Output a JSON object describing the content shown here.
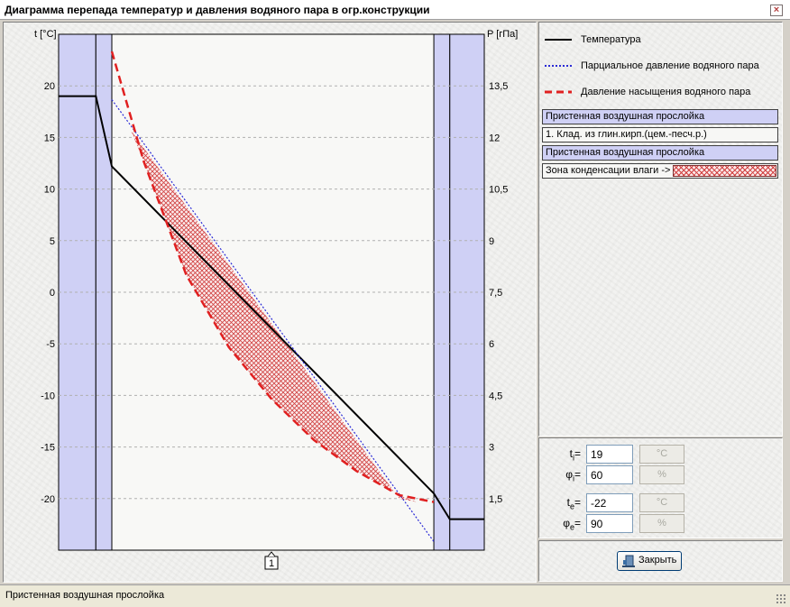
{
  "window": {
    "title": "Диаграмма перепада температур и давления водяного пара в огр.конструкции",
    "close_glyph": "×"
  },
  "legend": {
    "items": [
      {
        "label": "Температура",
        "color": "#000000",
        "style": "solid"
      },
      {
        "label": "Парциальное давление водяного пара",
        "color": "#2b2bd6",
        "style": "dotted"
      },
      {
        "label": "Давление насыщения водяного пара",
        "color": "#e02020",
        "style": "dashed"
      }
    ]
  },
  "layers": {
    "items": [
      "Пристенная воздушная прослойка",
      "1. Клад. из глин.кирп.(цем.-песч.р.)",
      "Пристенная воздушная прослойка"
    ],
    "condensation_label": "Зона конденсации влаги ->",
    "colors": {
      "air": "#cfd0f5",
      "condensation": "#d04040"
    }
  },
  "params": {
    "ti": {
      "sym": "t",
      "sub": "i",
      "value": "19",
      "unit": "°C"
    },
    "phii": {
      "sym": "φ",
      "sub": "i",
      "value": "60",
      "unit": "%"
    },
    "te": {
      "sym": "t",
      "sub": "e",
      "value": "-22",
      "unit": "°C"
    },
    "phie": {
      "sym": "φ",
      "sub": "e",
      "value": "90",
      "unit": "%"
    }
  },
  "close_button_label": "Закрыть",
  "status_text": "Пристенная воздушная прослойка",
  "chart_data": {
    "type": "line",
    "left_axis_label": "t [°C]",
    "right_axis_label": "P [гПа]",
    "left_ylim": [
      -25,
      25
    ],
    "left_ticks": [
      20,
      15,
      10,
      5,
      0,
      -5,
      -10,
      -15,
      -20
    ],
    "right_ylim": [
      0,
      15
    ],
    "right_ticks": [
      13.5,
      12,
      10.5,
      9,
      7.5,
      6,
      4.5,
      3,
      1.5
    ],
    "right_tick_labels": [
      "13,5",
      "12",
      "10,5",
      "9",
      "7,5",
      "6",
      "4,5",
      "3",
      "1,5"
    ],
    "grid": true,
    "layer_boundaries": [
      0,
      0.0875,
      0.125,
      0.8815,
      0.919,
      1
    ],
    "x_marker_label": "1",
    "x_marker_pos": 0.5,
    "series": [
      {
        "name": "Температура",
        "axis": "left",
        "color": "#000000",
        "x": [
          0,
          0.0875,
          0.125,
          0.8815,
          0.919,
          1
        ],
        "y": [
          19,
          19,
          12.2,
          -19.5,
          -22,
          -22
        ]
      },
      {
        "name": "Парциальное давление водяного пара",
        "axis": "right",
        "color": "#2b2bd6",
        "x": [
          0.125,
          0.8815
        ],
        "y": [
          13.1,
          0.25
        ]
      },
      {
        "name": "Давление насыщения водяного пара",
        "axis": "right",
        "color": "#e02020",
        "x": [
          0.125,
          0.2,
          0.3,
          0.4,
          0.5,
          0.6,
          0.7,
          0.8,
          0.8815
        ],
        "y": [
          14.5,
          11.3,
          8.0,
          5.9,
          4.4,
          3.2,
          2.3,
          1.6,
          1.4
        ]
      }
    ],
    "condensation_zone": {
      "x": [
        0.17,
        0.2,
        0.3,
        0.4,
        0.5,
        0.6,
        0.7,
        0.8,
        0.841
      ],
      "upper": [
        12.2,
        11.7,
        10.0,
        8.3,
        6.6,
        4.9,
        3.2,
        1.5,
        1.4
      ],
      "lower": [
        12.2,
        11.3,
        8.0,
        5.9,
        4.4,
        3.2,
        2.3,
        1.6,
        1.4
      ]
    }
  }
}
